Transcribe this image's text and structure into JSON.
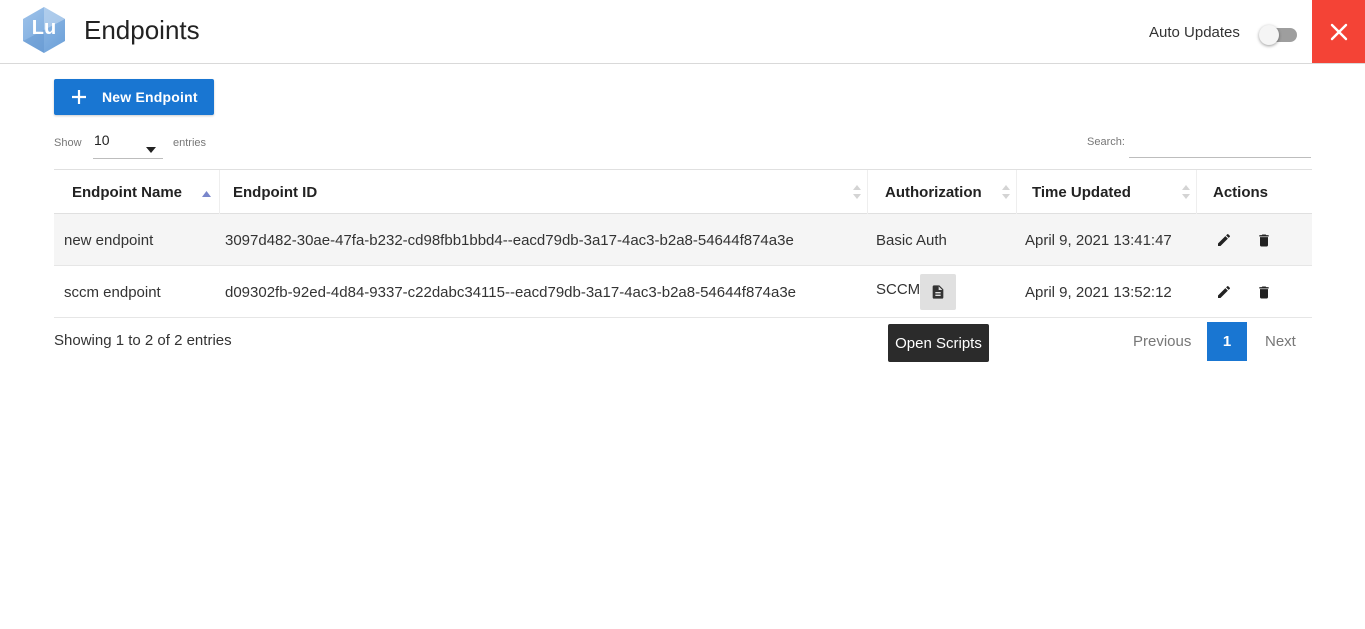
{
  "header": {
    "logo_text": "Lu",
    "title": "Endpoints",
    "auto_updates_label": "Auto Updates",
    "auto_updates_on": false
  },
  "toolbar": {
    "new_button_label": "New Endpoint",
    "show_label": "Show",
    "page_length": "10",
    "entries_label": "entries",
    "search_label": "Search:",
    "search_value": ""
  },
  "table": {
    "columns": [
      "Endpoint Name",
      "Endpoint ID",
      "Authorization",
      "Time Updated",
      "Actions"
    ],
    "sorted_column": "Endpoint Name",
    "sort_direction": "ascending",
    "rows": [
      {
        "name": "new endpoint",
        "id": "3097d482-30ae-47fa-b232-cd98fbb1bbd4--eacd79db-3a17-4ac3-b2a8-54644f874a3e",
        "authorization": "Basic Auth",
        "time_updated": "April 9, 2021 13:41:47"
      },
      {
        "name": "sccm endpoint",
        "id": "d09302fb-92ed-4d84-9337-c22dabc34115--eacd79db-3a17-4ac3-b2a8-54644f874a3e",
        "authorization": "SCCM",
        "time_updated": "April 9, 2021 13:52:12"
      }
    ]
  },
  "tooltip": "Open Scripts",
  "footer": {
    "info": "Showing 1 to 2 of 2 entries",
    "previous": "Previous",
    "current_page": "1",
    "next": "Next"
  },
  "colors": {
    "primary": "#1976d2",
    "close": "#f44336",
    "sort_active": "#7986cb"
  },
  "icons": {
    "close": "close-icon",
    "plus": "plus-icon",
    "edit": "pencil-icon",
    "delete": "trash-icon",
    "scripts": "document-icon",
    "caret": "caret-down-icon"
  }
}
